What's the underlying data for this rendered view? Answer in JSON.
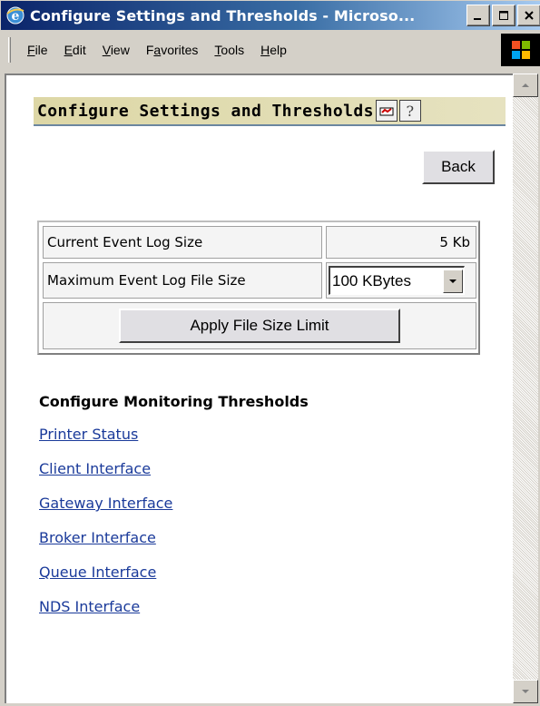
{
  "window": {
    "title": "Configure Settings and Thresholds - Microso...",
    "app_icon": "internet-explorer-icon",
    "controls": {
      "minimize": "_",
      "maximize": "□",
      "close": "×"
    }
  },
  "menubar": {
    "items": [
      {
        "label": "File",
        "mnemonic": "F"
      },
      {
        "label": "Edit",
        "mnemonic": "E"
      },
      {
        "label": "View",
        "mnemonic": "V"
      },
      {
        "label": "Favorites",
        "mnemonic": "a"
      },
      {
        "label": "Tools",
        "mnemonic": "T"
      },
      {
        "label": "Help",
        "mnemonic": "H"
      }
    ],
    "logo_icon": "windows-logo-icon"
  },
  "page": {
    "title": "Configure Settings and Thresholds",
    "header_icons": [
      "printer-status-icon",
      "help-icon"
    ],
    "help_glyph": "?",
    "back_label": "Back"
  },
  "settings": {
    "event_log_label": "Current Event Log Size",
    "event_log_value": "5 Kb",
    "max_size_label": "Maximum Event Log File Size",
    "max_size_selected": "100 KBytes",
    "apply_label": "Apply File Size Limit"
  },
  "monitoring": {
    "title": "Configure Monitoring Thresholds",
    "links": [
      "Printer Status",
      "Client Interface",
      "Gateway Interface",
      "Broker Interface",
      "Queue Interface",
      "NDS Interface"
    ]
  },
  "colors": {
    "titlebar_start": "#0a246a",
    "titlebar_end": "#a6caf0",
    "header_bg": "#ddd7a6",
    "link": "#1a3a9a",
    "chrome": "#d4d0c8"
  }
}
